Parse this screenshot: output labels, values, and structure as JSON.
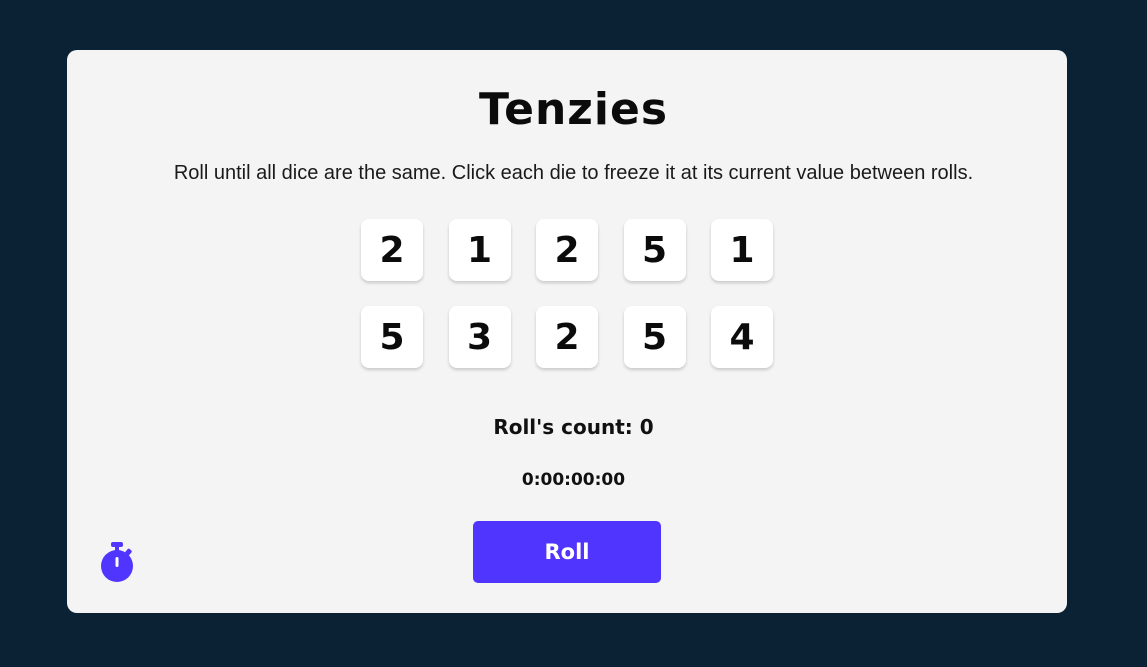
{
  "game": {
    "title": "Tenzies",
    "instructions": "Roll until all dice are the same. Click each die to freeze it at its current value between rolls."
  },
  "dice": [
    {
      "value": "2",
      "held": false
    },
    {
      "value": "1",
      "held": false
    },
    {
      "value": "2",
      "held": false
    },
    {
      "value": "5",
      "held": false
    },
    {
      "value": "1",
      "held": false
    },
    {
      "value": "5",
      "held": false
    },
    {
      "value": "3",
      "held": false
    },
    {
      "value": "2",
      "held": false
    },
    {
      "value": "5",
      "held": false
    },
    {
      "value": "4",
      "held": false
    }
  ],
  "stats": {
    "roll_count": "Roll's count: 0",
    "timer": "0:00:00:00"
  },
  "controls": {
    "roll_label": "Roll",
    "timer_icon": "stopwatch-icon"
  },
  "colors": {
    "background": "#0b2235",
    "board": "#f4f4f4",
    "die": "#ffffff",
    "accent": "#5035ff"
  }
}
